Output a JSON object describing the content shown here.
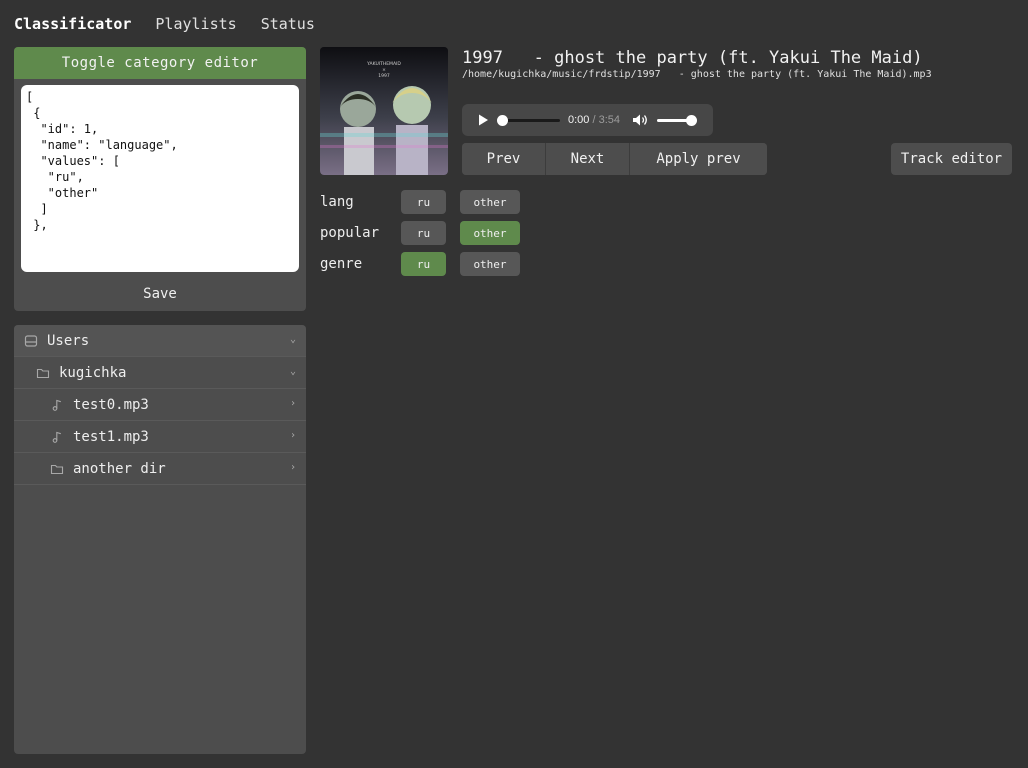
{
  "nav": {
    "brand": "Classificator",
    "links": [
      "Playlists",
      "Status"
    ]
  },
  "category_editor": {
    "toggle_label": "Toggle category editor",
    "json_text": "[\n {\n  \"id\": 1,\n  \"name\": \"language\",\n  \"values\": [\n   \"ru\",\n   \"other\"\n  ]\n },",
    "save_label": "Save"
  },
  "tree": [
    {
      "label": "Users",
      "icon": "drive-icon",
      "chevron": "⌄",
      "level": 0
    },
    {
      "label": "kugichka",
      "icon": "folder-icon",
      "chevron": "⌄",
      "level": 1
    },
    {
      "label": "test0.mp3",
      "icon": "music-note-icon",
      "chevron": "›",
      "level": 2
    },
    {
      "label": "test1.mp3",
      "icon": "music-note-icon",
      "chevron": "›",
      "level": 2
    },
    {
      "label": "another dir",
      "icon": "folder-icon",
      "chevron": "›",
      "level": 2
    }
  ],
  "track": {
    "title": "1997   - ghost the party (ft. Yakui The Maid)",
    "path": "/home/kugichka/music/frdstip/1997   - ghost the party (ft. Yakui The Maid).mp3",
    "cover_text": "YAKUITHEMAID\n×\n1997"
  },
  "player": {
    "current_time": "0:00",
    "duration": "/ 3:54",
    "progress": 0.0,
    "volume": 1.0
  },
  "controls": {
    "prev_label": "Prev",
    "next_label": "Next",
    "apply_prev_label": "Apply prev",
    "track_editor_label": "Track editor"
  },
  "categories": [
    {
      "label": "lang",
      "values": [
        "ru",
        "other"
      ],
      "selected": null
    },
    {
      "label": "popular",
      "values": [
        "ru",
        "other"
      ],
      "selected": "other"
    },
    {
      "label": "genre",
      "values": [
        "ru",
        "other"
      ],
      "selected": "ru"
    }
  ],
  "colors": {
    "accent": "#5f8a4c",
    "background": "#333333",
    "panel": "#4d4d4d"
  }
}
